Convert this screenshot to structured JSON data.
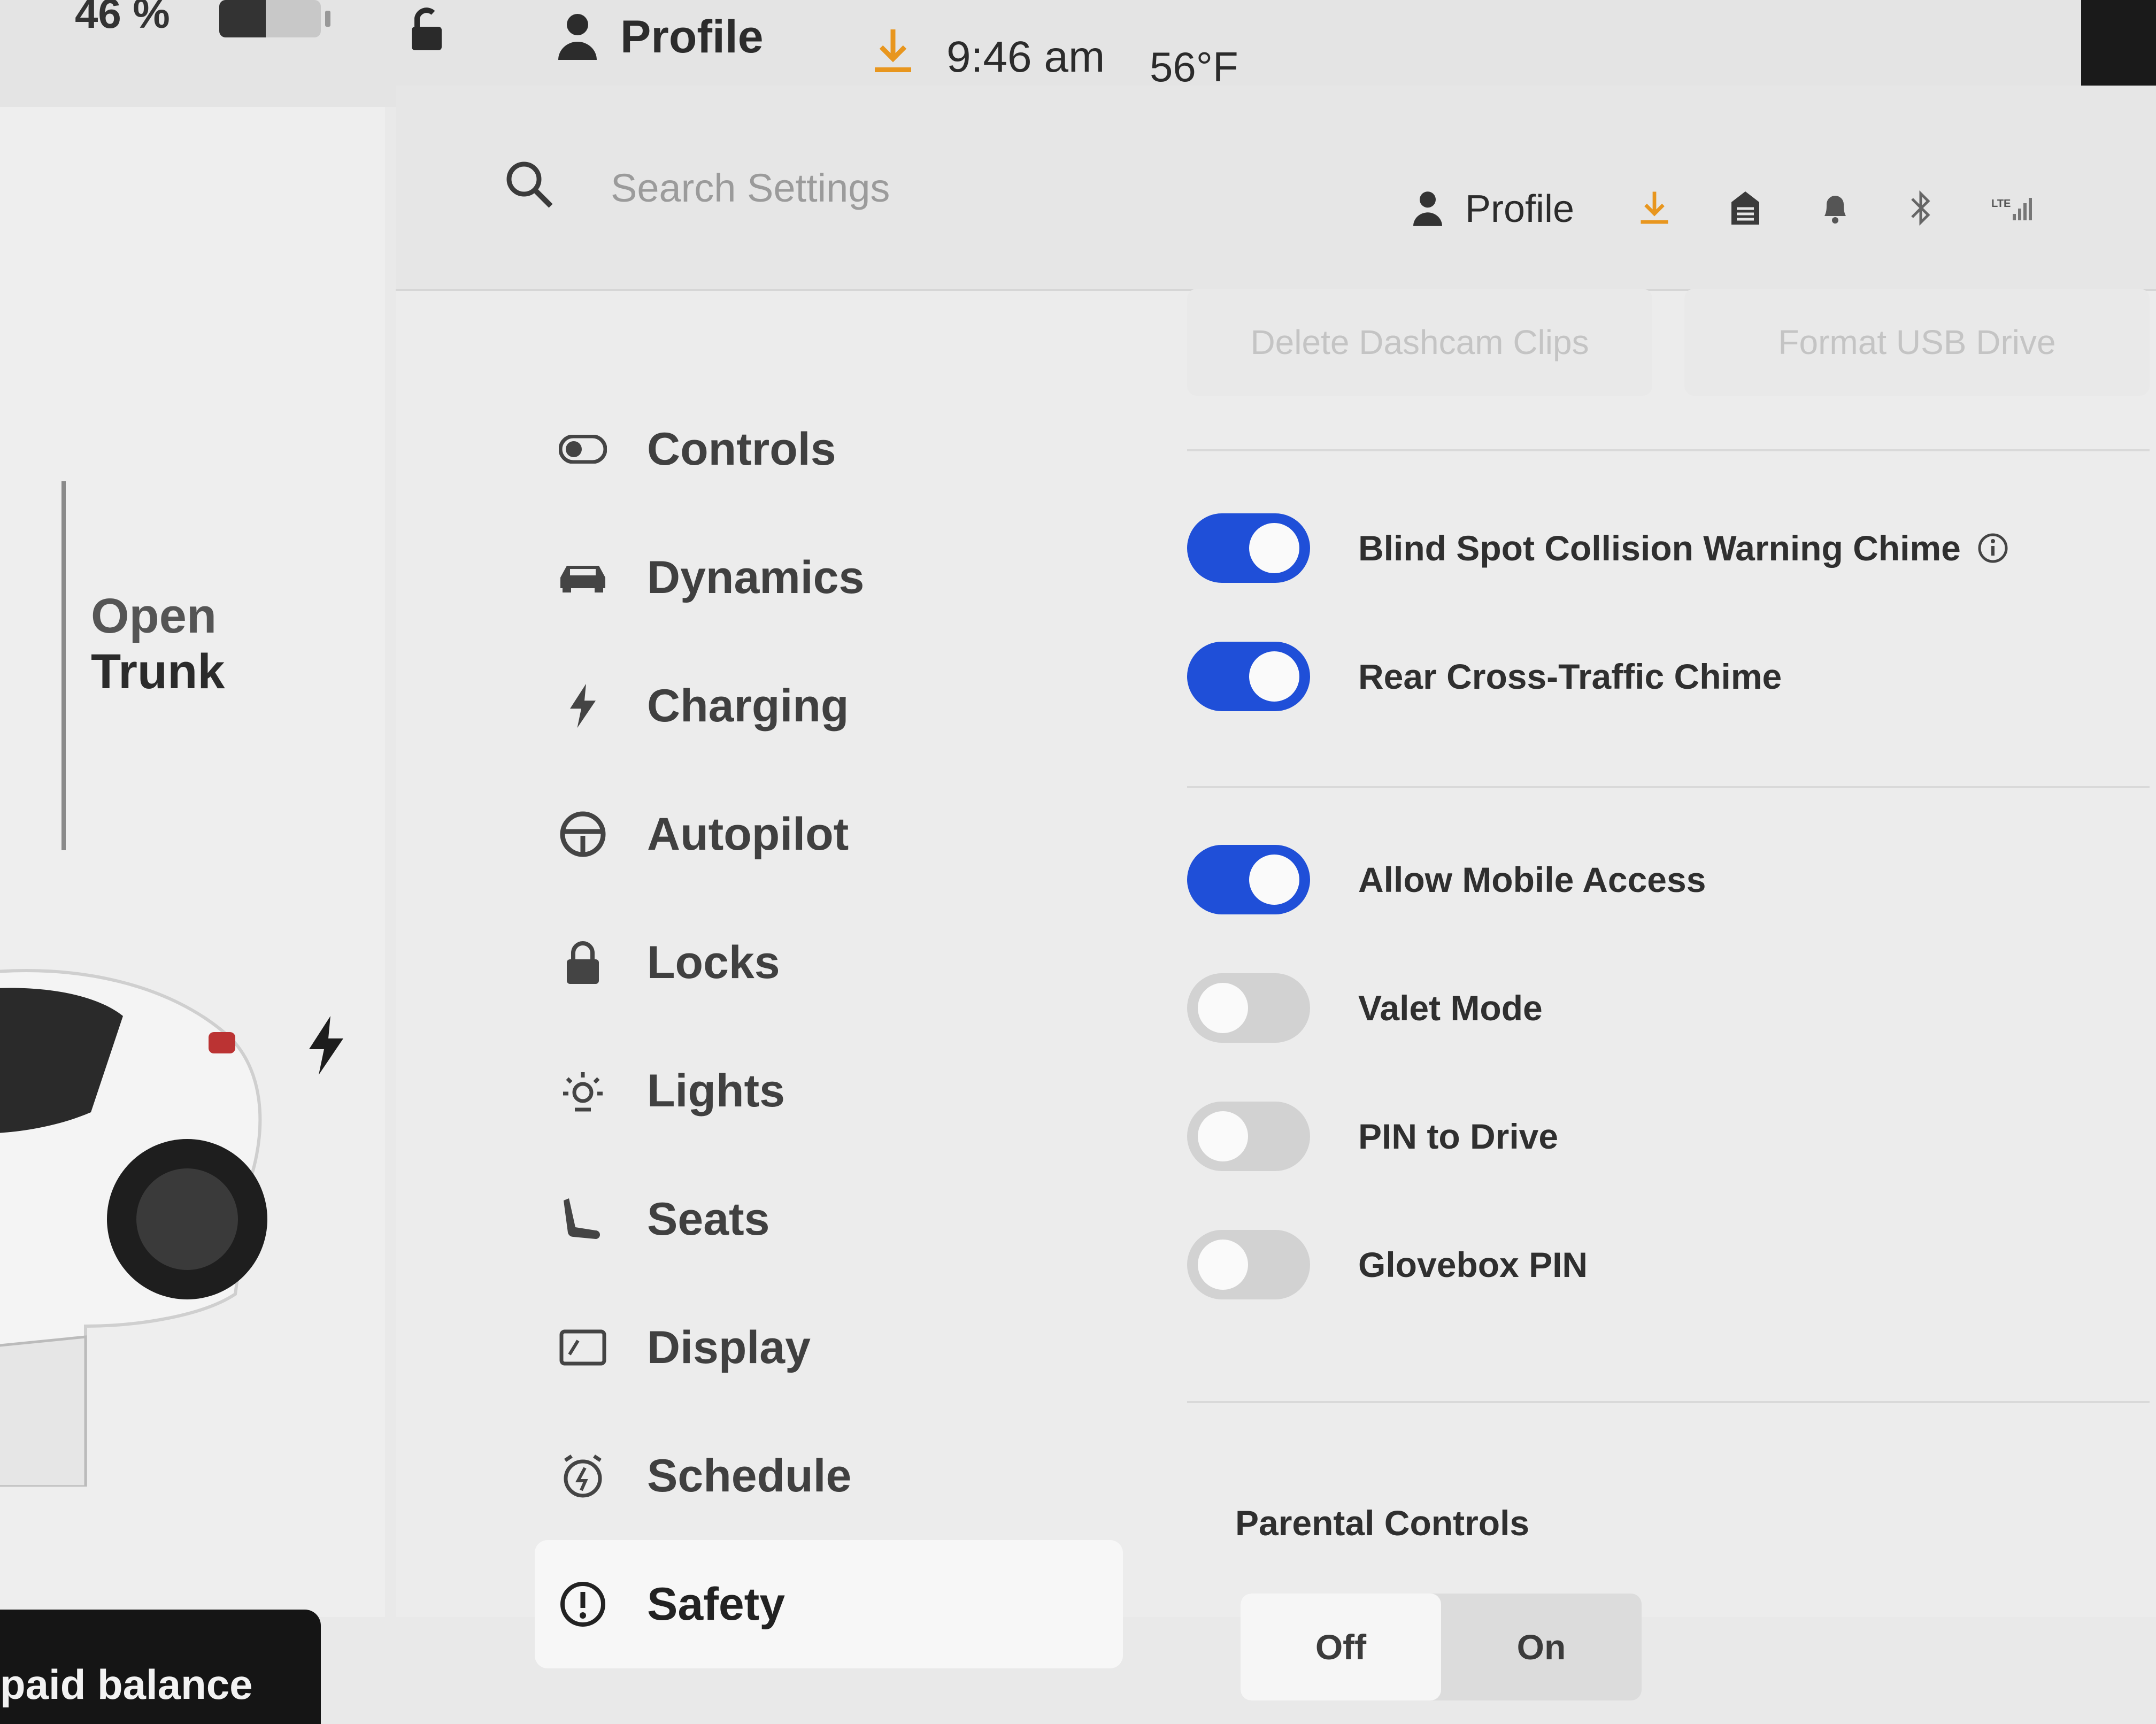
{
  "status_bar": {
    "battery_percent": "46 %",
    "battery_level": 0.46,
    "profile_label": "Profile",
    "time": "9:46 am",
    "temperature": "56°F",
    "icons": [
      "unlocked-icon",
      "person-icon",
      "download-icon"
    ]
  },
  "left_pane": {
    "trunk_line1": "Open",
    "trunk_line2": "Trunk",
    "balance_text": "paid balance"
  },
  "header": {
    "search_placeholder": "Search Settings",
    "profile_label": "Profile",
    "icons": [
      "person-icon",
      "download-icon",
      "garage-icon",
      "bell-icon",
      "bluetooth-icon",
      "lte-signal-icon"
    ],
    "lte_label": "LTE"
  },
  "nav": {
    "items": [
      {
        "label": "Controls",
        "icon": "toggle-icon"
      },
      {
        "label": "Dynamics",
        "icon": "car-icon"
      },
      {
        "label": "Charging",
        "icon": "bolt-icon"
      },
      {
        "label": "Autopilot",
        "icon": "steering-wheel-icon"
      },
      {
        "label": "Locks",
        "icon": "lock-icon"
      },
      {
        "label": "Lights",
        "icon": "light-icon"
      },
      {
        "label": "Seats",
        "icon": "seat-icon"
      },
      {
        "label": "Display",
        "icon": "display-icon"
      },
      {
        "label": "Schedule",
        "icon": "schedule-icon"
      },
      {
        "label": "Safety",
        "icon": "alert-circle-icon"
      }
    ],
    "active": "Safety"
  },
  "content": {
    "top_buttons": [
      "Delete Dashcam Clips",
      "Format USB Drive"
    ],
    "toggles": [
      {
        "label": "Blind Spot Collision Warning Chime",
        "on": true,
        "info": true
      },
      {
        "label": "Rear Cross-Traffic Chime",
        "on": true
      },
      {
        "label": "Allow Mobile Access",
        "on": true
      },
      {
        "label": "Valet Mode",
        "on": false
      },
      {
        "label": "PIN to Drive",
        "on": false
      },
      {
        "label": "Glovebox PIN",
        "on": false
      }
    ],
    "parental_controls": {
      "title": "Parental Controls",
      "options": [
        "Off",
        "On"
      ],
      "selected": "Off"
    }
  },
  "colors": {
    "accent_blue": "#1f4fd8",
    "download_orange": "#e8961e"
  }
}
